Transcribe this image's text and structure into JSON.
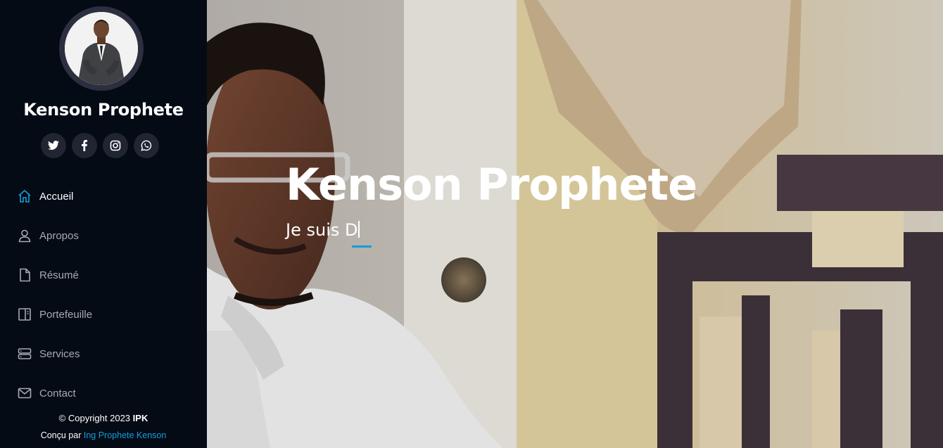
{
  "profile": {
    "name": "Kenson Prophete"
  },
  "social": [
    {
      "icon": "twitter-icon"
    },
    {
      "icon": "facebook-icon"
    },
    {
      "icon": "instagram-icon"
    },
    {
      "icon": "whatsapp-icon"
    }
  ],
  "nav": {
    "items": [
      {
        "label": "Accueil",
        "icon": "home-icon",
        "active": true
      },
      {
        "label": "Apropos",
        "icon": "person-icon"
      },
      {
        "label": "Résumé",
        "icon": "file-icon"
      },
      {
        "label": "Portefeuille",
        "icon": "book-icon"
      },
      {
        "label": "Services",
        "icon": "server-icon"
      },
      {
        "label": "Contact",
        "icon": "envelope-icon"
      }
    ]
  },
  "footer": {
    "copyright_prefix": "© Copyright 2023",
    "copyright_brand": "IPK",
    "credits_prefix": "Conçu par",
    "credits_link": "Ing Prophete Kenson"
  },
  "hero": {
    "title": "Kenson Prophete",
    "subtitle": "Je suis D"
  },
  "colors": {
    "accent": "#149ddd",
    "sidebar_bg": "#040b14",
    "social_bg": "#212431"
  }
}
